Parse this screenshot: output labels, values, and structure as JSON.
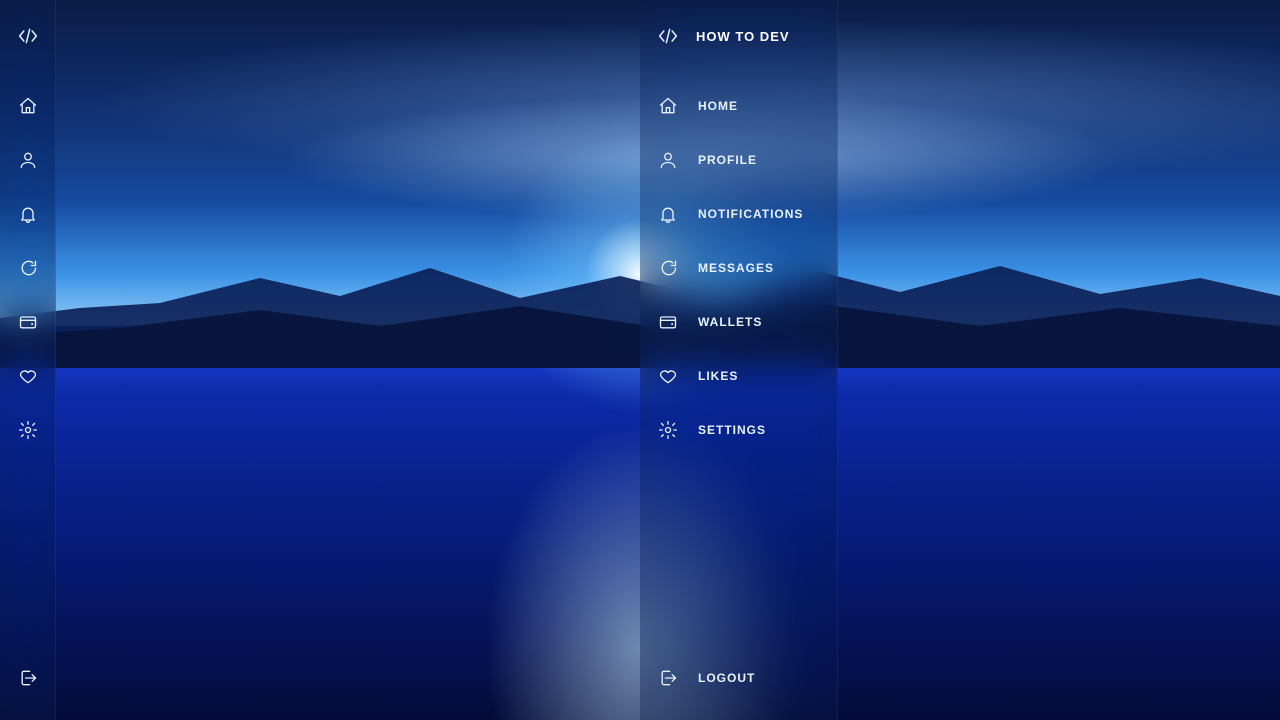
{
  "brand": {
    "title": "HOW TO DEV"
  },
  "nav": {
    "items": [
      {
        "label": "HOME"
      },
      {
        "label": "PROFILE"
      },
      {
        "label": "NOTIFICATIONS"
      },
      {
        "label": "MESSAGES"
      },
      {
        "label": "WALLETS"
      },
      {
        "label": "LIKES"
      },
      {
        "label": "SETTINGS"
      }
    ],
    "logout": {
      "label": "LOGOUT"
    }
  }
}
